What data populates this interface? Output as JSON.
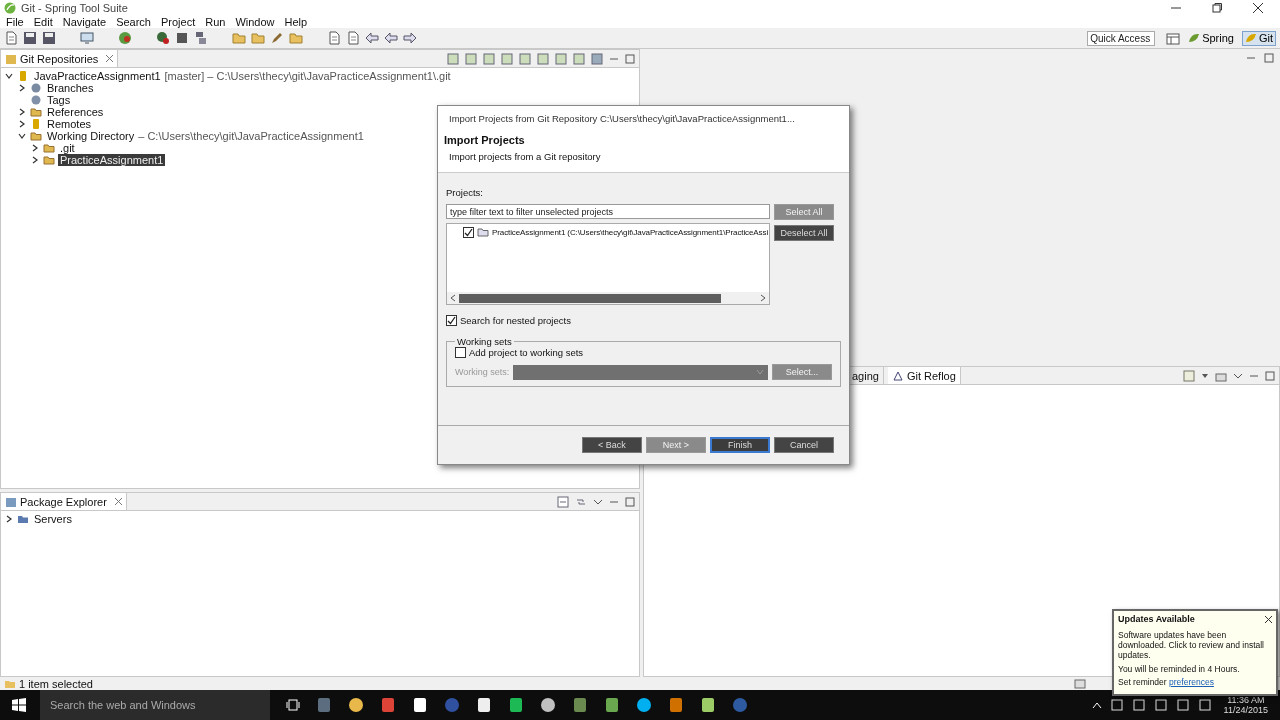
{
  "window": {
    "title": "Git - Spring Tool Suite"
  },
  "menu": [
    "File",
    "Edit",
    "Navigate",
    "Search",
    "Project",
    "Run",
    "Window",
    "Help"
  ],
  "quick_access": {
    "placeholder": "Quick Access"
  },
  "perspectives": [
    {
      "label": "Spring",
      "selected": false
    },
    {
      "label": "Git",
      "selected": true
    }
  ],
  "git_repositories": {
    "tab": "Git Repositories",
    "tree": [
      {
        "label": "JavaPracticeAssignment1",
        "detail": "[master] – C:\\Users\\thecy\\git\\JavaPracticeAssignment1\\.git",
        "kind": "repo",
        "expanded": true,
        "selected": false,
        "children": [
          {
            "label": "Branches",
            "kind": "branches",
            "expanded": false,
            "selected": false
          },
          {
            "label": "Tags",
            "kind": "tags",
            "selected": false
          },
          {
            "label": "References",
            "kind": "folder",
            "expanded": false,
            "selected": false
          },
          {
            "label": "Remotes",
            "kind": "remote",
            "expanded": false,
            "selected": false
          },
          {
            "label": "Working Directory",
            "detail": "– C:\\Users\\thecy\\git\\JavaPracticeAssignment1",
            "kind": "folder",
            "expanded": true,
            "selected": false,
            "children": [
              {
                "label": ".git",
                "kind": "folder",
                "expanded": false,
                "selected": false
              },
              {
                "label": "PracticeAssignment1",
                "kind": "folder",
                "expanded": false,
                "selected": true
              }
            ]
          }
        ]
      }
    ]
  },
  "package_explorer": {
    "tab": "Package Explorer",
    "tree": [
      {
        "label": "Servers",
        "kind": "project",
        "expanded": false,
        "selected": false
      }
    ]
  },
  "bottom_panel": {
    "tabs": [
      {
        "label": "aging",
        "selected": false
      },
      {
        "label": "Git Reflog",
        "selected": true
      }
    ]
  },
  "status_bar": "1 item selected",
  "dialog": {
    "title": "Import Projects from Git Repository C:\\Users\\thecy\\git\\JavaPracticeAssignment1...",
    "heading": "Import Projects",
    "description": "Import projects from a Git repository",
    "projects_label": "Projects:",
    "filter": {
      "placeholder": "type filter text to filter unselected projects"
    },
    "projects": [
      {
        "label": "PracticeAssignment1 (C:\\Users\\thecy\\git\\JavaPracticeAssignment1\\PracticeAssi",
        "checked": true
      }
    ],
    "side_buttons": [
      {
        "label": "Select All",
        "disabled": true
      },
      {
        "label": "Deselect All",
        "disabled": false
      }
    ],
    "nested": {
      "label": "Search for nested projects",
      "checked": true
    },
    "working_sets": {
      "title": "Working sets",
      "add": {
        "label": "Add project to working sets",
        "checked": false
      },
      "field_label": "Working sets:",
      "button": {
        "label": "Select...",
        "disabled": true
      }
    },
    "buttons": [
      {
        "label": "< Back",
        "disabled": false,
        "default": false
      },
      {
        "label": "Next >",
        "disabled": true,
        "default": false
      },
      {
        "label": "Finish",
        "disabled": false,
        "default": true
      },
      {
        "label": "Cancel",
        "disabled": false,
        "default": false
      }
    ]
  },
  "notification": {
    "title": "Updates Available",
    "message": "Software updates have been downloaded. Click to review and install updates.",
    "reminder": "You will be reminded in 4 Hours.",
    "link_prefix": "Set reminder",
    "link": "preferences"
  },
  "taskbar": {
    "search": {
      "placeholder": "Search the web and Windows"
    },
    "time": "11:36 AM",
    "date": "11/24/2015"
  }
}
